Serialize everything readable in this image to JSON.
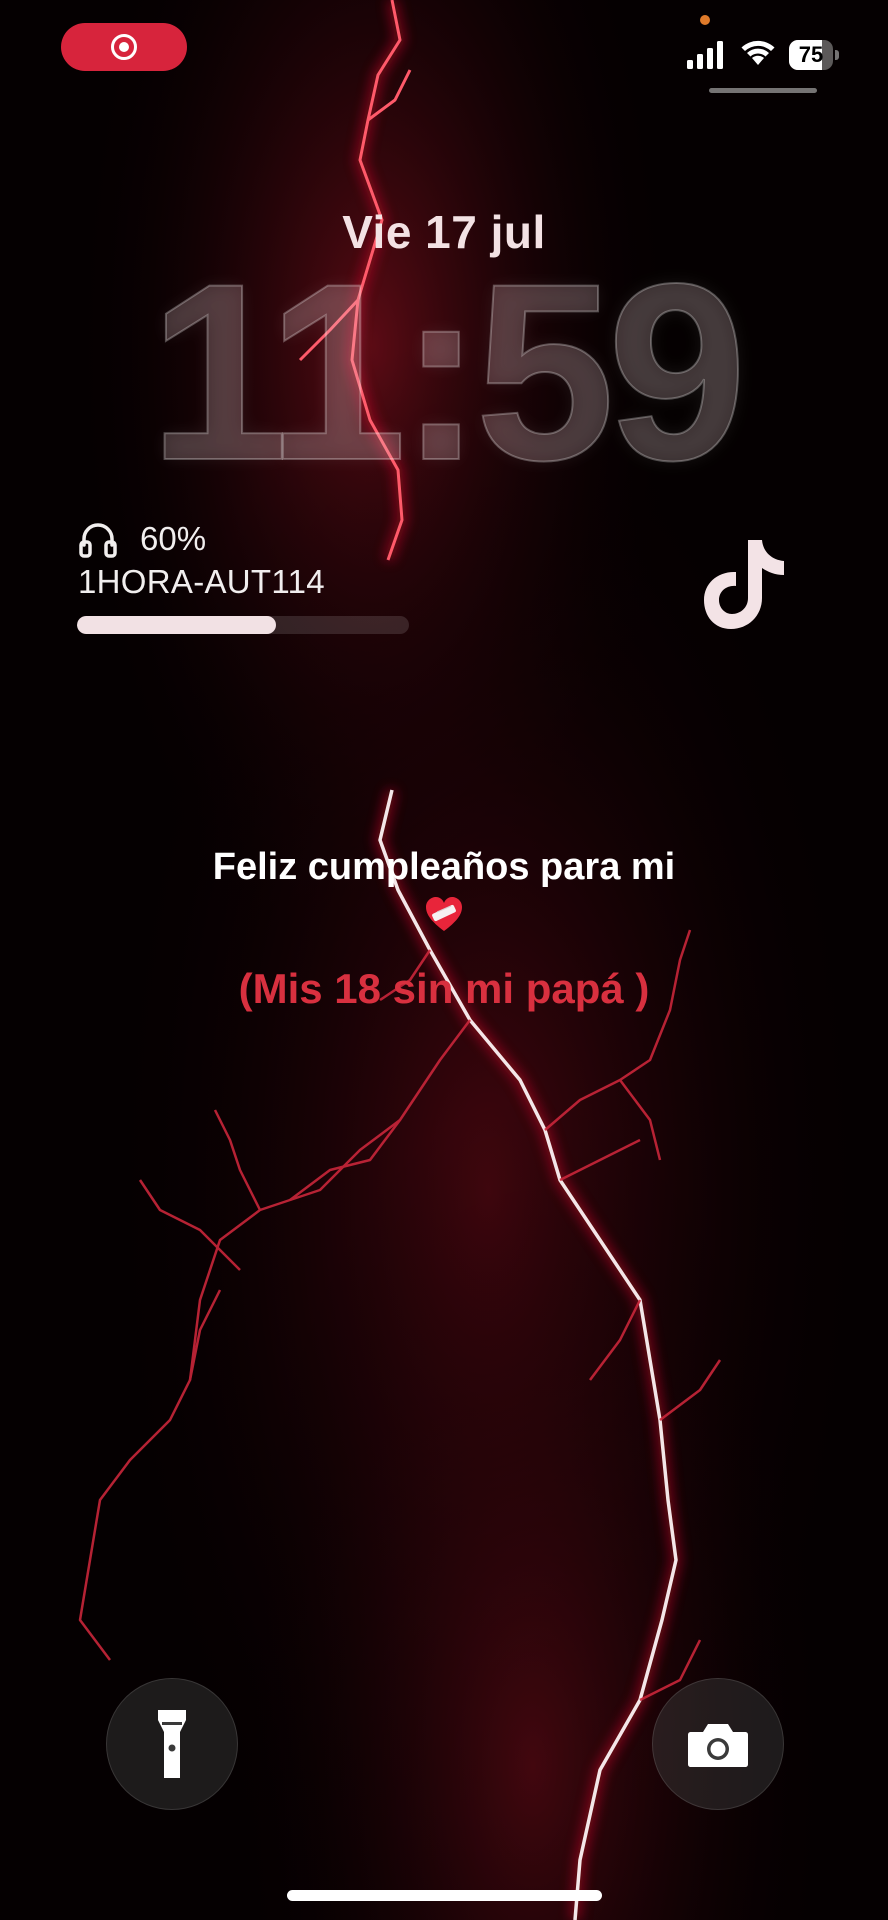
{
  "status_bar": {
    "recording_indicator": "record-icon",
    "battery_level": 75,
    "battery_label": "75",
    "signal_icon": "cellular-signal-icon",
    "wifi_icon": "wifi-icon",
    "mic_indicator_color": "#e07a2a"
  },
  "lock_screen": {
    "date": "Vie 17 jul",
    "time": "11:59"
  },
  "widget": {
    "icon": "headphones-icon",
    "battery_percent": "60%",
    "device_name": "1HORA-AUT114",
    "battery_fraction": 0.6
  },
  "app_icon": "tiktok-icon",
  "caption": {
    "line1": "Feliz cumpleaños para mi",
    "emoji": "mending-heart-icon",
    "line2": "(Mis 18 sin mi papá )",
    "line2_color": "#d8303f"
  },
  "bottom_controls": {
    "left": "flashlight-icon",
    "right": "camera-icon"
  },
  "colors": {
    "background": "#000000",
    "record_pill": "#d7243c",
    "lightning": "#c0182c"
  }
}
